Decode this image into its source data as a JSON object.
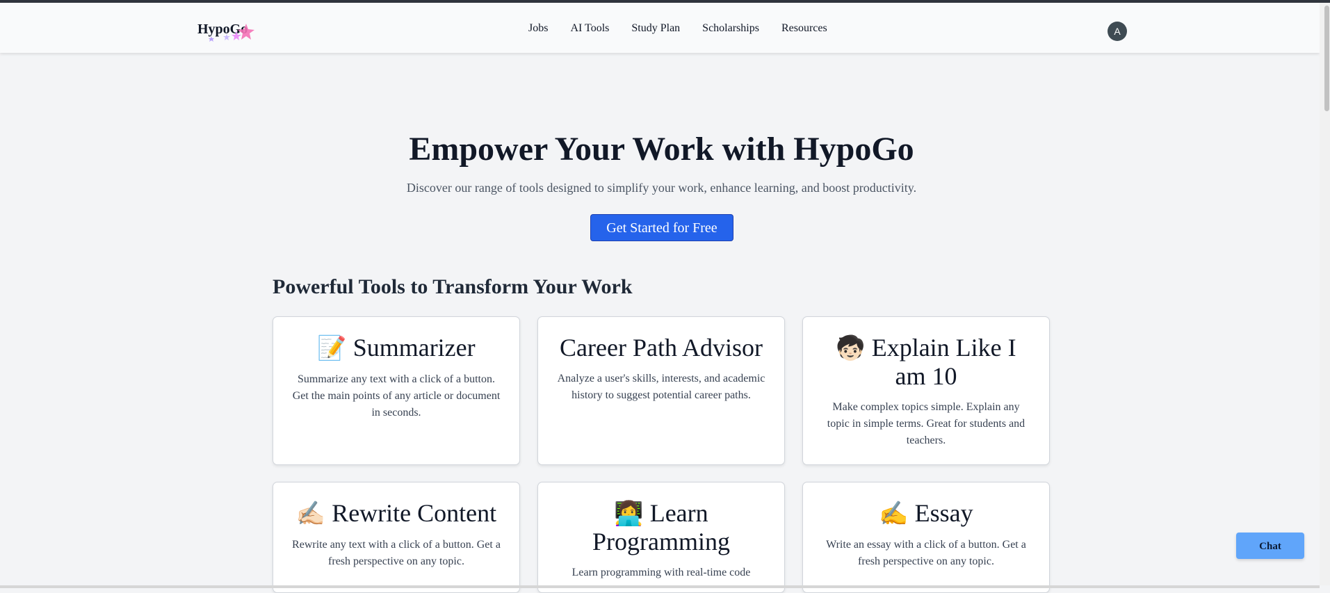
{
  "header": {
    "logo": "HypoGo",
    "nav": [
      "Jobs",
      "AI Tools",
      "Study Plan",
      "Scholarships",
      "Resources"
    ],
    "avatar_initial": "A"
  },
  "hero": {
    "title": "Empower Your Work with HypoGo",
    "subtitle": "Discover our range of tools designed to simplify your work, enhance learning, and boost productivity.",
    "cta_label": "Get Started for Free"
  },
  "tools_section": {
    "title": "Powerful Tools to Transform Your Work",
    "cards": [
      {
        "icon": "memo-icon",
        "emoji": "📝",
        "title": "Summarizer",
        "description": "Summarize any text with a click of a button. Get the main points of any article or document in seconds."
      },
      {
        "icon": "",
        "emoji": "",
        "title": "Career Path Advisor",
        "description": "Analyze a user's skills, interests, and academic history to suggest potential career paths."
      },
      {
        "icon": "boy-icon",
        "emoji": "🧒🏻",
        "title": "Explain Like I am 10",
        "description": "Make complex topics simple. Explain any topic in simple terms. Great for students and teachers."
      },
      {
        "icon": "writing-hand-icon",
        "emoji": "✍🏻",
        "title": "Rewrite Content",
        "description": "Rewrite any text with a click of a button. Get a fresh perspective on any topic."
      },
      {
        "icon": "technologist-icon",
        "emoji": "👩‍💻",
        "title": "Learn Programming",
        "description": "Learn programming with real-time code"
      },
      {
        "icon": "writing-hand-icon",
        "emoji": "✍️",
        "title": "Essay",
        "description": "Write an essay with a click of a button. Get a fresh perspective on any topic."
      }
    ]
  },
  "chat": {
    "label": "Chat"
  },
  "colors": {
    "primary": "#2563eb",
    "chat": "#60a5fa",
    "background": "#f3f4f6",
    "text": "#111827"
  }
}
